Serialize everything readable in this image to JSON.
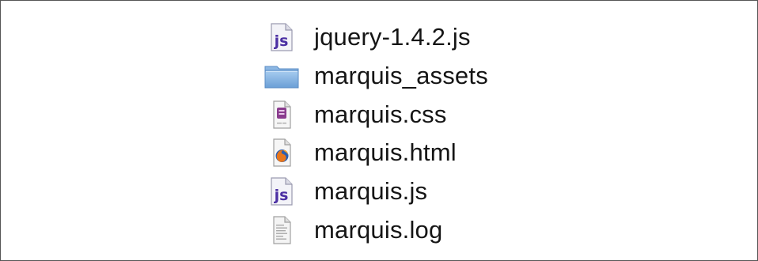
{
  "files": [
    {
      "name": "jquery-1.4.2.js",
      "icon": "js-file-icon"
    },
    {
      "name": "marquis_assets",
      "icon": "folder-icon"
    },
    {
      "name": "marquis.css",
      "icon": "css-file-icon"
    },
    {
      "name": "marquis.html",
      "icon": "html-file-icon"
    },
    {
      "name": "marquis.js",
      "icon": "js-file-icon"
    },
    {
      "name": "marquis.log",
      "icon": "log-file-icon"
    }
  ],
  "icons": {
    "js_badge": "js"
  },
  "colors": {
    "js_purple": "#4b2fa3",
    "folder_blue": "#7eaee0",
    "firefox_orange": "#e8761c",
    "css_purple": "#8a3c8e"
  }
}
